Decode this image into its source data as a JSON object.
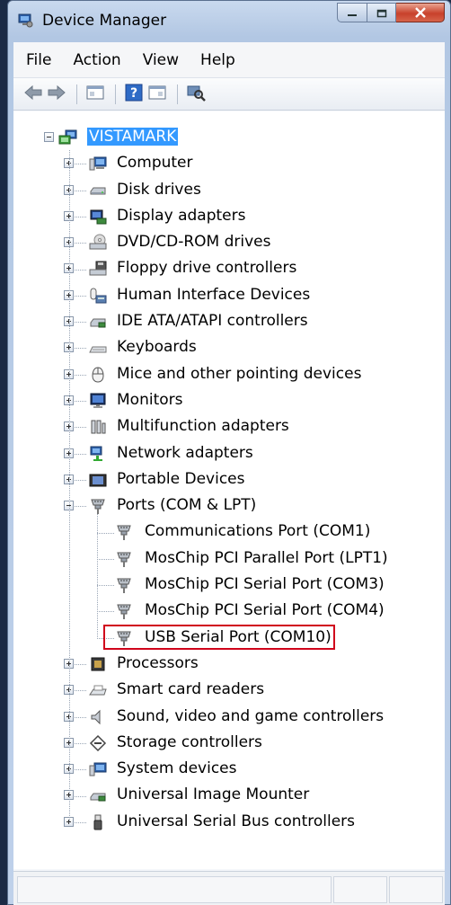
{
  "window": {
    "title": "Device Manager",
    "controls": {
      "minimize": "minimize",
      "maximize": "maximize",
      "close": "close"
    }
  },
  "menu": [
    "File",
    "Action",
    "View",
    "Help"
  ],
  "toolbar": {
    "buttons": [
      "back-arrow-icon",
      "forward-arrow-icon",
      "show-hide-tree-icon",
      "help-icon",
      "properties-icon",
      "scan-hardware-icon"
    ]
  },
  "tree": {
    "root": "VISTAMARK",
    "categories": [
      {
        "label": "Computer",
        "icon": "computer-icon",
        "expanded": false
      },
      {
        "label": "Disk drives",
        "icon": "disk-drive-icon",
        "expanded": false
      },
      {
        "label": "Display adapters",
        "icon": "display-adapter-icon",
        "expanded": false
      },
      {
        "label": "DVD/CD-ROM drives",
        "icon": "dvd-drive-icon",
        "expanded": false
      },
      {
        "label": "Floppy drive controllers",
        "icon": "floppy-controller-icon",
        "expanded": false
      },
      {
        "label": "Human Interface Devices",
        "icon": "hid-icon",
        "expanded": false
      },
      {
        "label": "IDE ATA/ATAPI controllers",
        "icon": "ide-controller-icon",
        "expanded": false
      },
      {
        "label": "Keyboards",
        "icon": "keyboard-icon",
        "expanded": false
      },
      {
        "label": "Mice and other pointing devices",
        "icon": "mouse-icon",
        "expanded": false
      },
      {
        "label": "Monitors",
        "icon": "monitor-icon",
        "expanded": false
      },
      {
        "label": "Multifunction adapters",
        "icon": "multifunction-icon",
        "expanded": false
      },
      {
        "label": "Network adapters",
        "icon": "network-adapter-icon",
        "expanded": false
      },
      {
        "label": "Portable Devices",
        "icon": "portable-device-icon",
        "expanded": false
      },
      {
        "label": "Ports (COM & LPT)",
        "icon": "port-icon",
        "expanded": true,
        "children": [
          "Communications Port (COM1)",
          "MosChip PCI Parallel Port (LPT1)",
          "MosChip PCI Serial Port (COM3)",
          "MosChip PCI Serial Port (COM4)",
          "USB Serial Port (COM10)"
        ]
      },
      {
        "label": "Processors",
        "icon": "processor-icon",
        "expanded": false
      },
      {
        "label": "Smart card readers",
        "icon": "smart-card-reader-icon",
        "expanded": false
      },
      {
        "label": "Sound, video and game controllers",
        "icon": "sound-icon",
        "expanded": false
      },
      {
        "label": "Storage controllers",
        "icon": "storage-controller-icon",
        "expanded": false
      },
      {
        "label": "System devices",
        "icon": "system-device-icon",
        "expanded": false
      },
      {
        "label": "Universal Image Mounter",
        "icon": "image-mounter-icon",
        "expanded": false
      },
      {
        "label": "Universal Serial Bus controllers",
        "icon": "usb-icon",
        "expanded": false
      }
    ],
    "highlighted_child": "USB Serial Port (COM10)"
  },
  "colors": {
    "selection": "#3399ff",
    "highlight_box": "#d0021b",
    "close_button": "#c8412b"
  }
}
